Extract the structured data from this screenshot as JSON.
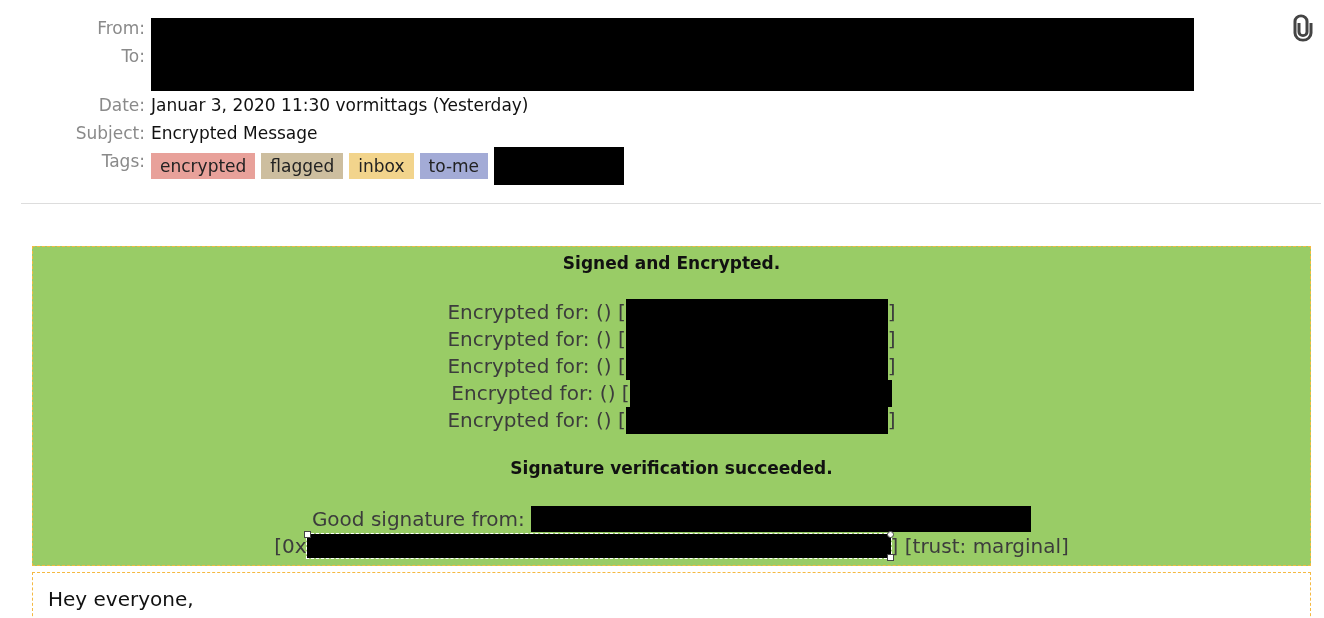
{
  "header": {
    "address_labels": [
      "From:",
      "To:"
    ],
    "date": {
      "label": "Date:",
      "value": "Januar 3, 2020 11:30 vormittags (Yesterday)"
    },
    "subject": {
      "label": "Subject:",
      "value": "Encrypted Message"
    },
    "tags": {
      "label": "Tags:",
      "items": [
        {
          "text": "encrypted",
          "color": "#e8a19a"
        },
        {
          "text": "flagged",
          "color": "#cdbe9f"
        },
        {
          "text": "inbox",
          "color": "#f2d48c"
        },
        {
          "text": "to-me",
          "color": "#a3abd6"
        }
      ]
    }
  },
  "crypto_status": {
    "encryption_title": "Signed and Encrypted.",
    "recipients": [
      {
        "prefix": "Encrypted for: () [",
        "suffix": "]"
      },
      {
        "prefix": "Encrypted for: () [",
        "suffix": "]"
      },
      {
        "prefix": "Encrypted for: () [",
        "suffix": "]"
      },
      {
        "prefix": "Encrypted for: () ["
      },
      {
        "prefix": "Encrypted for: () [",
        "suffix": "]"
      }
    ],
    "signature_title": "Signature verification succeeded.",
    "signer_label": "Good signature from:",
    "key_prefix": "[0x",
    "key_suffix": "] [trust: marginal]"
  },
  "body": {
    "text": "Hey everyone,"
  }
}
